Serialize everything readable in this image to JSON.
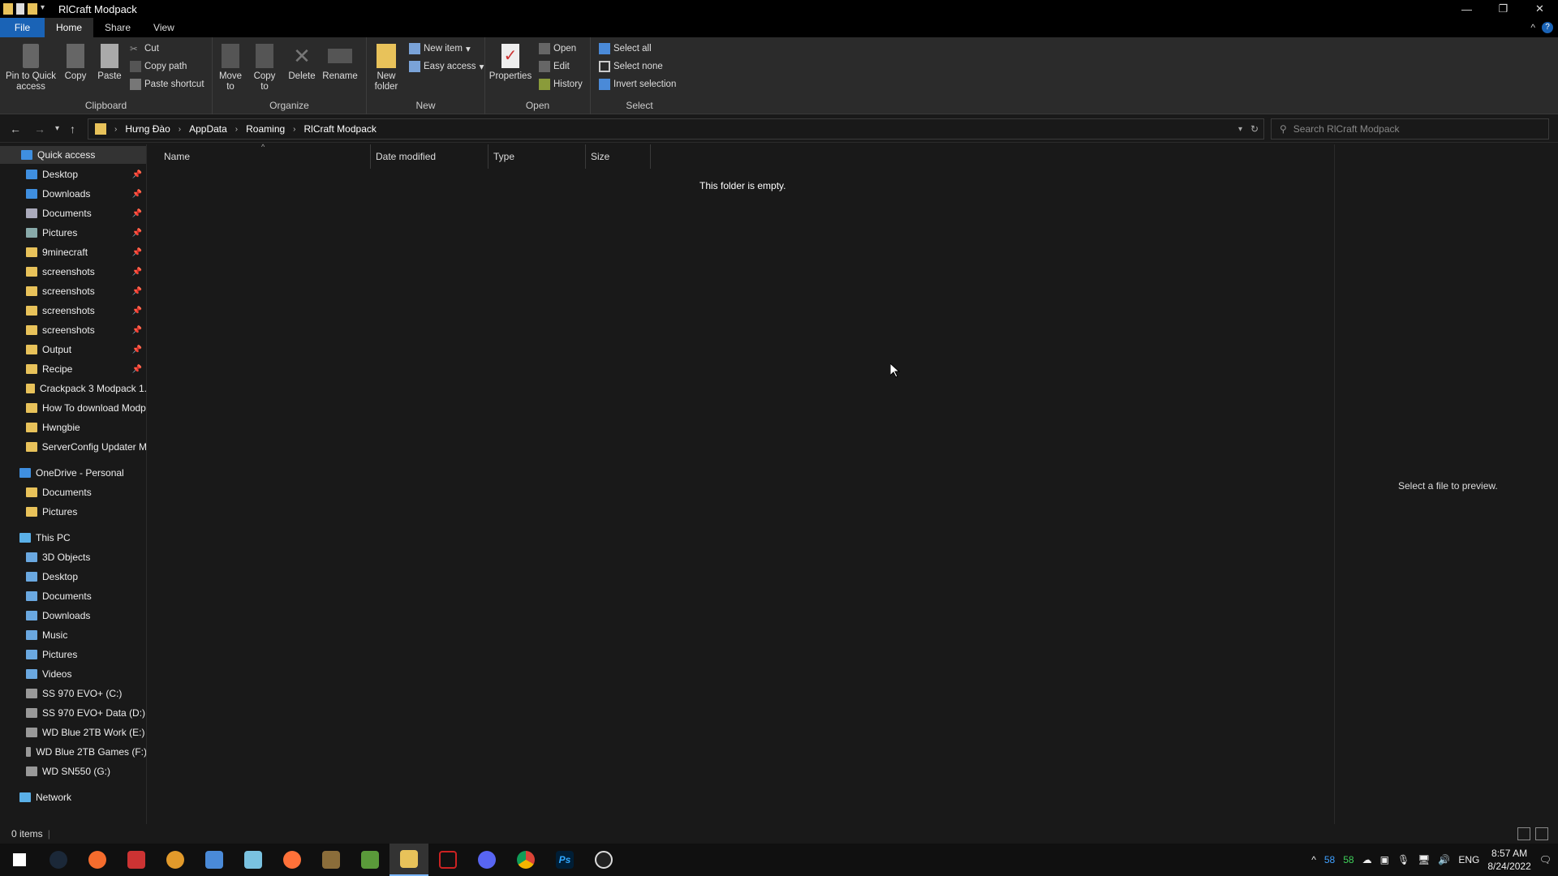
{
  "window": {
    "title": "RlCraft Modpack"
  },
  "tabs": [
    "File",
    "Home",
    "Share",
    "View"
  ],
  "ribbon": {
    "clipboard": {
      "label": "Clipboard",
      "pin": "Pin to Quick access",
      "copy": "Copy",
      "paste": "Paste",
      "cut": "Cut",
      "copy_path": "Copy path",
      "paste_shortcut": "Paste shortcut"
    },
    "organize": {
      "label": "Organize",
      "move_to": "Move to",
      "copy_to": "Copy to",
      "delete": "Delete",
      "rename": "Rename"
    },
    "new": {
      "label": "New",
      "new_folder": "New folder",
      "new_item": "New item",
      "easy_access": "Easy access"
    },
    "open": {
      "label": "Open",
      "properties": "Properties",
      "open": "Open",
      "edit": "Edit",
      "history": "History"
    },
    "select": {
      "label": "Select",
      "select_all": "Select all",
      "select_none": "Select none",
      "invert": "Invert selection"
    }
  },
  "address": {
    "crumbs": [
      "Hưng Đào",
      "AppData",
      "Roaming",
      "RlCraft Modpack"
    ],
    "search_placeholder": "Search RlCraft Modpack"
  },
  "nav": {
    "quick_access": "Quick access",
    "quick_items": [
      "Desktop",
      "Downloads",
      "Documents",
      "Pictures",
      "9minecraft",
      "screenshots",
      "screenshots",
      "screenshots",
      "screenshots",
      "Output",
      "Recipe",
      "Crackpack 3 Modpack 1.",
      "How To download Modp",
      "Hwngbie",
      "ServerConfig Updater M"
    ],
    "onedrive": "OneDrive - Personal",
    "onedrive_items": [
      "Documents",
      "Pictures"
    ],
    "this_pc": "This PC",
    "pc_items": [
      "3D Objects",
      "Desktop",
      "Documents",
      "Downloads",
      "Music",
      "Pictures",
      "Videos",
      "SS 970 EVO+ (C:)",
      "SS 970 EVO+ Data (D:)",
      "WD Blue 2TB Work (E:)",
      "WD Blue 2TB Games (F:)",
      "WD SN550 (G:)"
    ],
    "network": "Network"
  },
  "columns": [
    "Name",
    "Date modified",
    "Type",
    "Size"
  ],
  "empty_message": "This folder is empty.",
  "preview_message": "Select a file to preview.",
  "status": {
    "items": "0 items"
  },
  "tray": {
    "n1": "58",
    "n2": "58",
    "lang": "ENG",
    "time": "8:57 AM",
    "date": "8/24/2022"
  }
}
